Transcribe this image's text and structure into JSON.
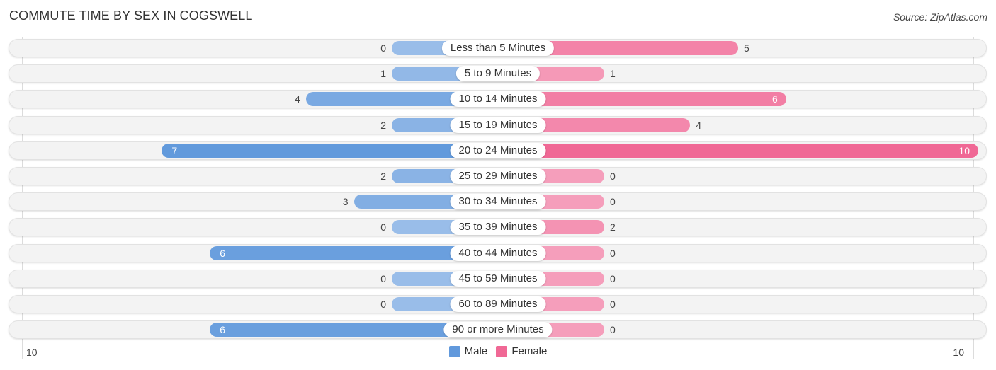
{
  "title": "COMMUTE TIME BY SEX IN COGSWELL",
  "source": "Source: ZipAtlas.com",
  "chart_data": {
    "type": "bar",
    "orientation": "horizontal-diverging",
    "title": "COMMUTE TIME BY SEX IN COGSWELL",
    "categories": [
      "Less than 5 Minutes",
      "5 to 9 Minutes",
      "10 to 14 Minutes",
      "15 to 19 Minutes",
      "20 to 24 Minutes",
      "25 to 29 Minutes",
      "30 to 34 Minutes",
      "35 to 39 Minutes",
      "40 to 44 Minutes",
      "45 to 59 Minutes",
      "60 to 89 Minutes",
      "90 or more Minutes"
    ],
    "series": [
      {
        "name": "Male",
        "color": "#6199dc",
        "values": [
          0,
          1,
          4,
          2,
          7,
          2,
          3,
          0,
          6,
          0,
          0,
          6
        ]
      },
      {
        "name": "Female",
        "color": "#f06895",
        "values": [
          5,
          1,
          6,
          4,
          10,
          0,
          0,
          2,
          0,
          0,
          0,
          0
        ]
      }
    ],
    "xlim": [
      -10,
      10
    ],
    "axis_labels": {
      "left": "10",
      "right": "10"
    },
    "legend": {
      "position": "bottom-center",
      "entries": [
        "Male",
        "Female"
      ]
    },
    "grid": false
  }
}
